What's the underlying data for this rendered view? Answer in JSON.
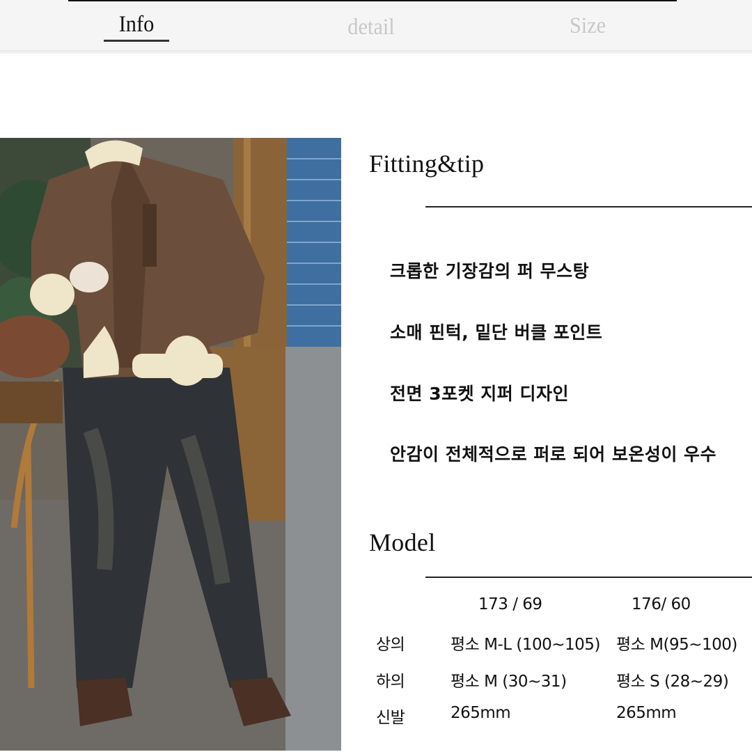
{
  "tabs": [
    {
      "label": "Info",
      "active": true
    },
    {
      "label": "detail",
      "active": false
    },
    {
      "label": "Size",
      "active": false
    }
  ],
  "photo": {
    "description": "Model wearing brown shearling mustang jacket with cream fur trim, faded dark wide-leg jeans and brown square-toe shoes, holding a coffee cup in a cafe"
  },
  "fitting": {
    "title": "Fitting&tip",
    "tips": [
      "크롭한 기장감의 퍼 무스탕",
      "소매 핀턱, 밑단 버클 포인트",
      "전면 3포켓 지퍼 디자인",
      "안감이 전체적으로 퍼로 되어 보온성이 우수"
    ]
  },
  "model": {
    "title": "Model",
    "headers": [
      "173 / 69",
      "176/ 60"
    ],
    "rows": [
      {
        "label": "상의",
        "values": [
          "평소 M-L (100~105)",
          "평소 M(95~100)"
        ]
      },
      {
        "label": "하의",
        "values": [
          "평소 M (30~31)",
          "평소 S (28~29)"
        ]
      },
      {
        "label": "신발",
        "values": [
          "265mm",
          "265mm"
        ]
      }
    ]
  },
  "colors": {
    "tab_active": "#111111",
    "tab_inactive": "#c8c8c8",
    "tabbar_bg": "#f5f5f5"
  }
}
